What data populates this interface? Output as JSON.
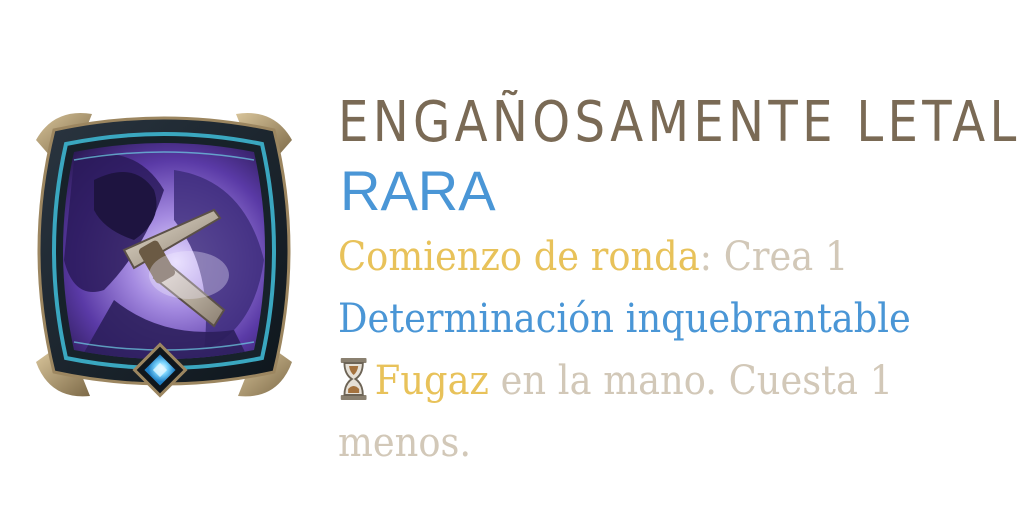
{
  "card": {
    "title": "ENGAÑOSAMENTE LETAL",
    "rarity": "RARA",
    "icon_name": "dagger-artwork-icon",
    "gem_icon_name": "rarity-gem-icon",
    "description": {
      "kw1": "Comienzo de ronda",
      "colon": ":",
      "t1": " Crea 1",
      "kw2": "Determinación inquebrantable",
      "kw3": "Fugaz",
      "t2": " en la mano. Cuesta 1",
      "t3": "menos.",
      "hourglass_icon": "hourglass-icon"
    },
    "colors": {
      "title": "#7a6a55",
      "rarity": "#4a96d6",
      "keyword_gold": "#e8c25a",
      "keyword_blue": "#4a96d6",
      "body_text": "#d2c8b8",
      "frame_gold": "#9c8660",
      "frame_dark": "#1c2730",
      "frame_teal": "#3aa7c0",
      "art_purple": "#5a3aa6"
    }
  }
}
